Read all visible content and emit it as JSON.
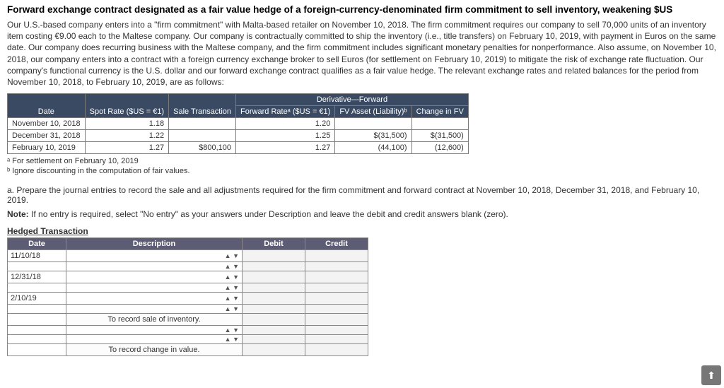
{
  "title": "Forward exchange contract designated as a fair value hedge of a foreign-currency-denominated firm commitment to sell inventory, weakening $US",
  "description": "Our U.S.-based company enters into a \"firm commitment\" with Malta-based retailer on November 10, 2018. The firm commitment requires our company to sell 70,000 units of an inventory item costing €9.00 each to the Maltese company. Our company is contractually committed to ship the inventory (i.e., title transfers) on February 10, 2019, with payment in Euros on the same date. Our company does recurring business with the Maltese company, and the firm commitment includes significant monetary penalties for nonperformance. Also assume, on November 10, 2018, our company enters into a contract with a foreign currency exchange broker to sell Euros (for settlement on February 10, 2019) to mitigate the risk of exchange rate fluctuation. Our company's functional currency is the U.S. dollar and our forward exchange contract qualifies as a fair value hedge. The relevant exchange rates and related balances for the period from November 10, 2018, to February 10, 2019, are as follows:",
  "deriv_table": {
    "super_header": "Derivative—Forward",
    "headers": {
      "date": "Date",
      "spot": "Spot Rate ($US = €1)",
      "sale": "Sale Transaction",
      "fwd": "Forward Rateᵃ ($US = €1)",
      "fv": "FV Asset (Liability)ᵇ",
      "chg": "Change in FV"
    },
    "rows": [
      {
        "date": "November 10, 2018",
        "spot": "1.18",
        "sale": "",
        "fwd": "1.20",
        "fv": "",
        "chg": ""
      },
      {
        "date": "December 31, 2018",
        "spot": "1.22",
        "sale": "",
        "fwd": "1.25",
        "fv": "$(31,500)",
        "chg": "$(31,500)"
      },
      {
        "date": "February 10, 2019",
        "spot": "1.27",
        "sale": "$800,100",
        "fwd": "1.27",
        "fv": "(44,100)",
        "chg": "(12,600)"
      }
    ]
  },
  "footnote_a": "ᵃ For settlement on February 10, 2019",
  "footnote_b": "ᵇ Ignore discounting in the computation of fair values.",
  "question_a": "a. Prepare the journal entries to record the sale and all adjustments required for the firm commitment and forward contract at November 10, 2018, December 31, 2018, and February 10, 2019.",
  "note": "Note: If no entry is required, select \"No entry\" as your answers under Description and leave the debit and credit answers blank (zero).",
  "section_head": "Hedged Transaction",
  "journal": {
    "headers": {
      "date": "Date",
      "desc": "Description",
      "debit": "Debit",
      "credit": "Credit"
    },
    "rows": [
      {
        "date": "11/10/18",
        "desc_select": true
      },
      {
        "date": "",
        "desc_select": true
      },
      {
        "date": "12/31/18",
        "desc_select": true
      },
      {
        "date": "",
        "desc_select": true
      },
      {
        "date": "2/10/19",
        "desc_select": true
      },
      {
        "date": "",
        "desc_select": true
      },
      {
        "date": "",
        "desc_static": "To record sale of inventory."
      },
      {
        "date": "",
        "desc_select": true
      },
      {
        "date": "",
        "desc_select": true
      },
      {
        "date": "",
        "desc_static": "To record change in value."
      }
    ]
  },
  "scroll_glyph": "⬆"
}
